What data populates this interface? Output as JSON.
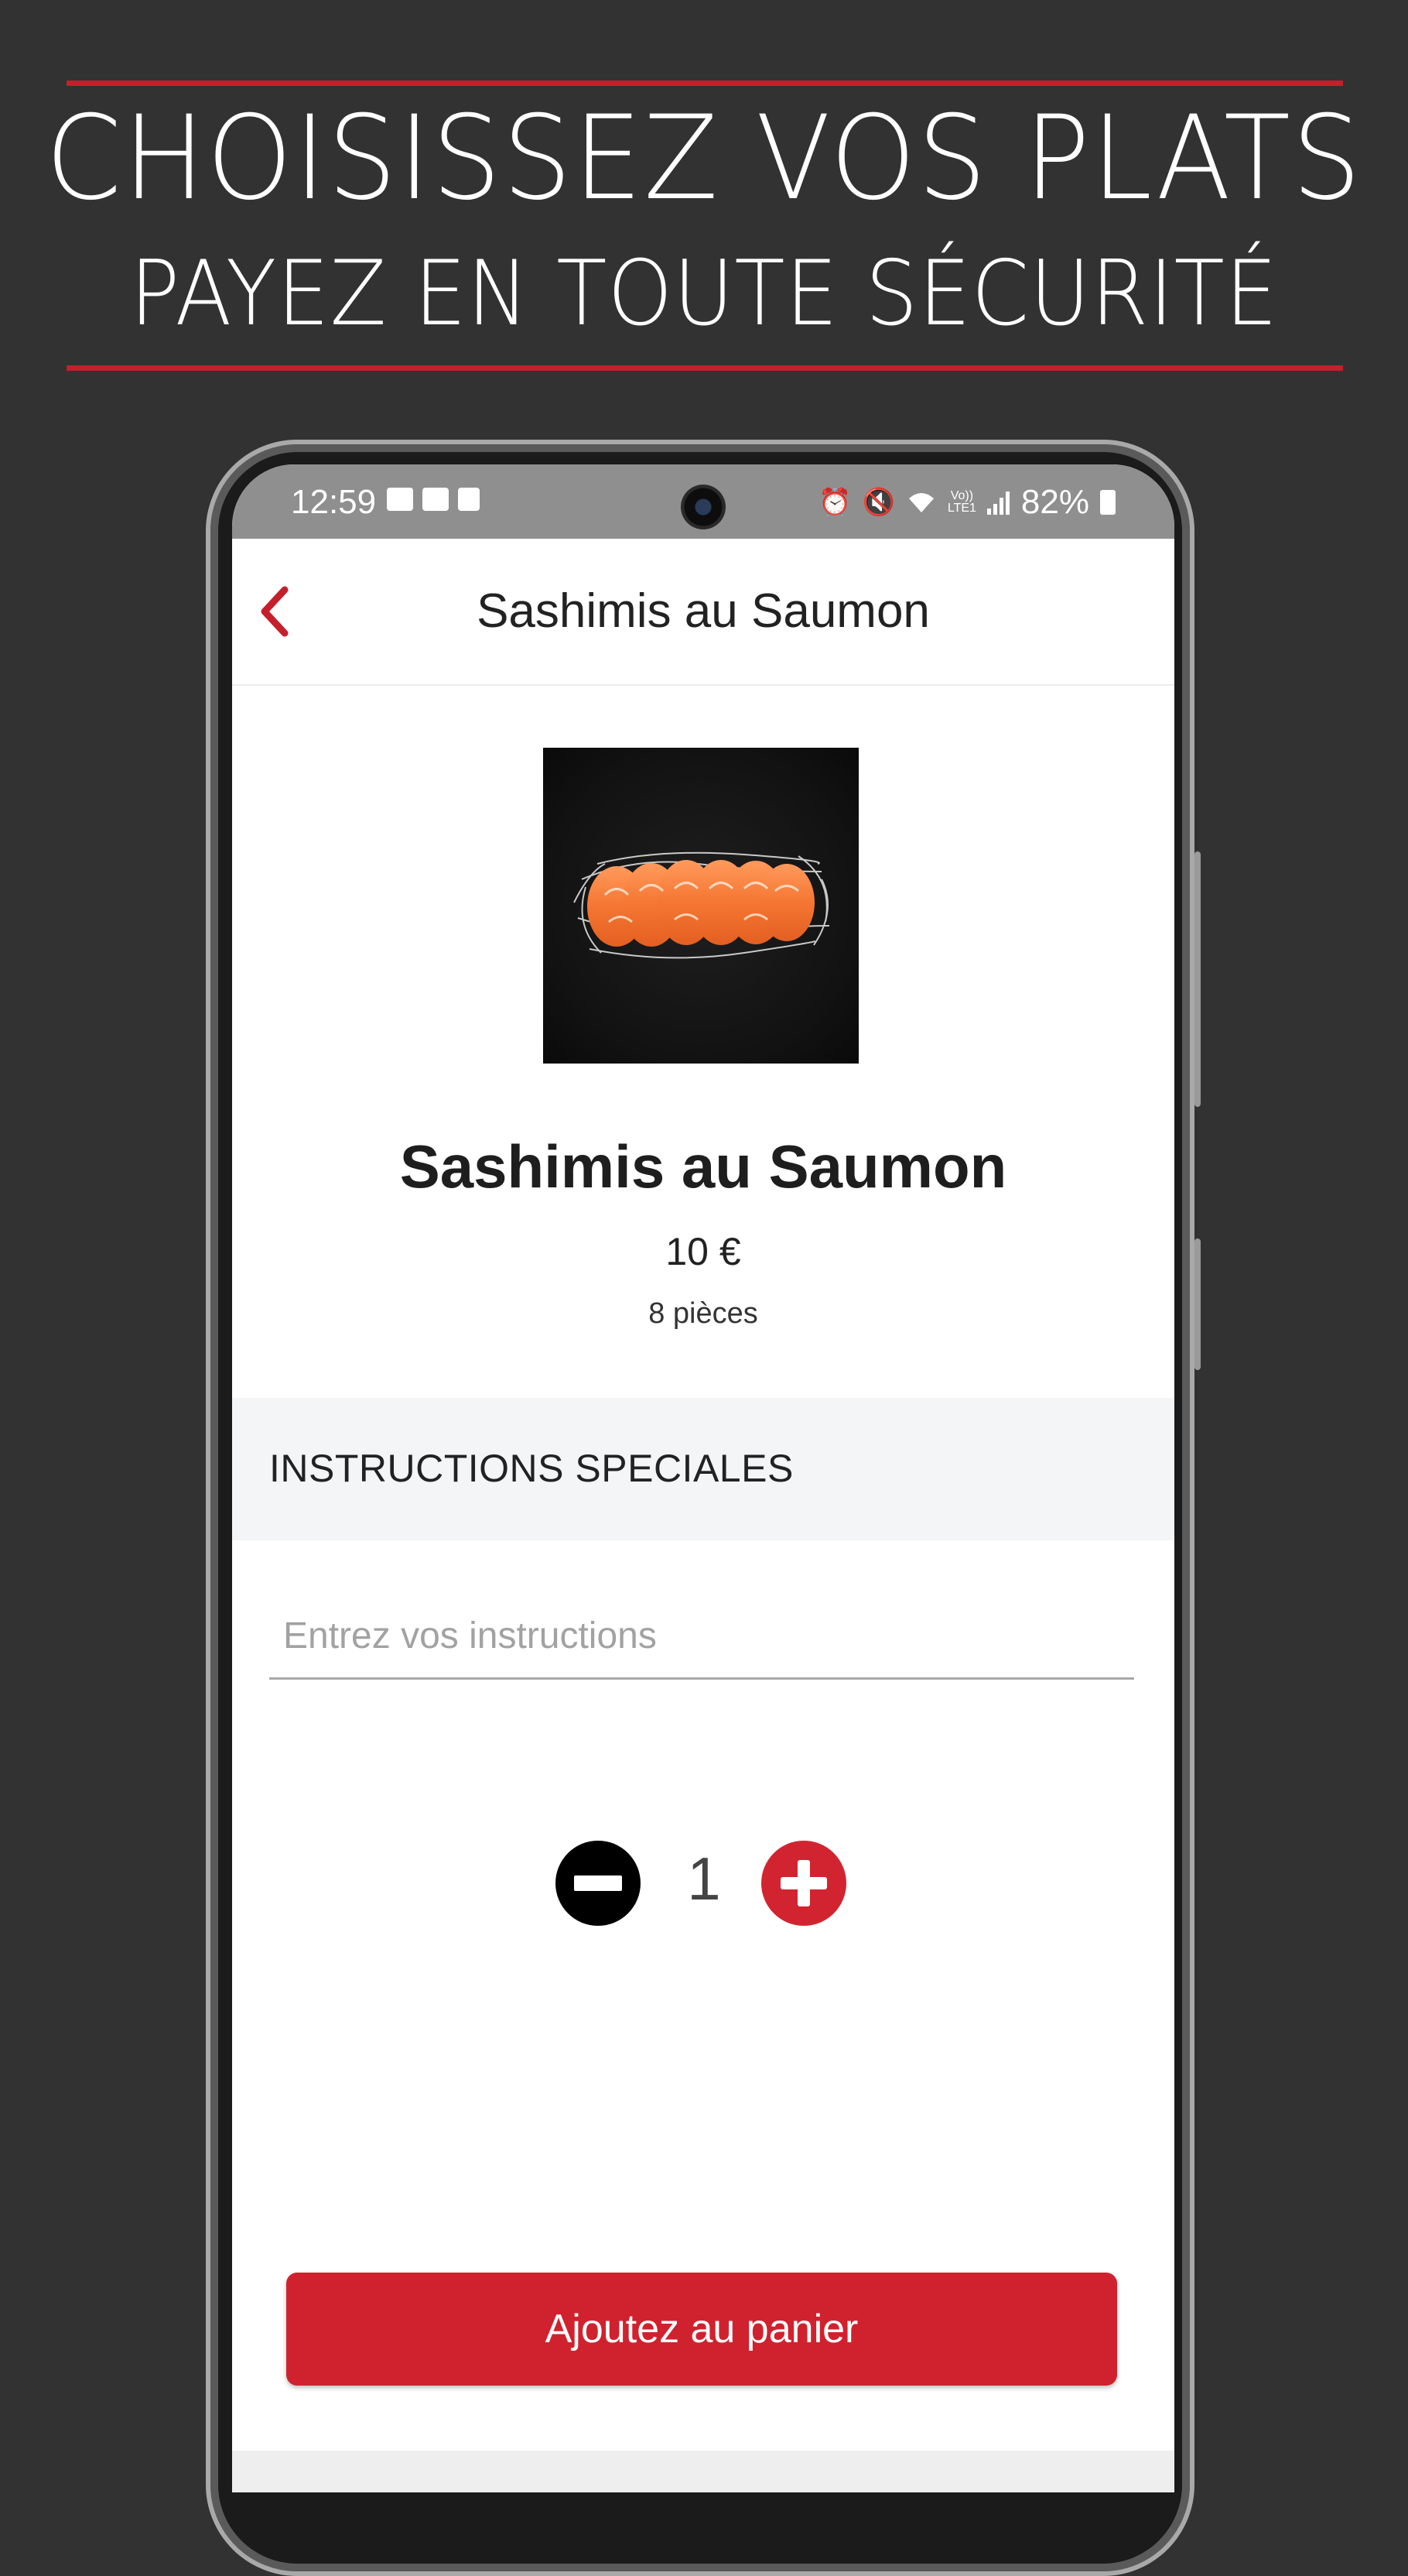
{
  "promo": {
    "line1": "CHOISISSEZ VOS PLATS",
    "line2": "PAYEZ EN TOUTE SÉCURITÉ"
  },
  "status_bar": {
    "time": "12:59",
    "network_label": "Vo))\nLTE1",
    "battery": "82%"
  },
  "app_bar": {
    "title": "Sashimis au Saumon",
    "back_icon": "chevron-left-icon"
  },
  "product": {
    "image_alt": "salmon sashimi on shredded daikon",
    "name": "Sashimis au Saumon",
    "price": "10 €",
    "description": "8 pièces"
  },
  "special_instructions": {
    "header": "INSTRUCTIONS SPECIALES",
    "placeholder": "Entrez vos instructions",
    "value": ""
  },
  "quantity": {
    "count": "1"
  },
  "actions": {
    "add_to_cart": "Ajoutez au panier"
  },
  "colors": {
    "accent": "#d0222e",
    "background": "#323232"
  }
}
